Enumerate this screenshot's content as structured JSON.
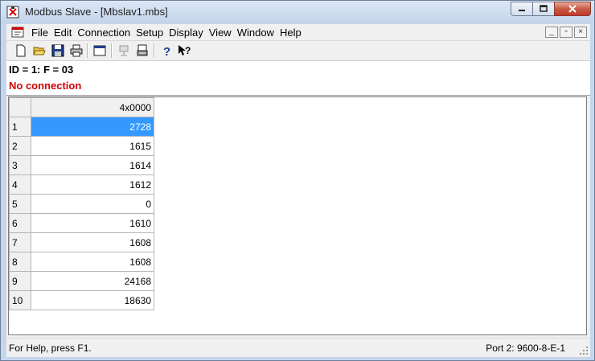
{
  "window": {
    "title": "Modbus Slave - [Mbslav1.mbs]"
  },
  "menu": [
    "File",
    "Edit",
    "Connection",
    "Setup",
    "Display",
    "View",
    "Window",
    "Help"
  ],
  "toolbar": {
    "icons": [
      "new-icon",
      "open-icon",
      "save-icon",
      "print-icon",
      "window-icon",
      "connect-icon",
      "disconnect-icon",
      "help-icon",
      "context-help-icon"
    ]
  },
  "info": {
    "id_line": "ID = 1: F = 03",
    "connection_status": "No connection",
    "status_color": "#d00000"
  },
  "grid": {
    "column_header": "4x0000",
    "rows": [
      {
        "num": "1",
        "value": "2728"
      },
      {
        "num": "2",
        "value": "1615"
      },
      {
        "num": "3",
        "value": "1614"
      },
      {
        "num": "4",
        "value": "1612"
      },
      {
        "num": "5",
        "value": "0"
      },
      {
        "num": "6",
        "value": "1610"
      },
      {
        "num": "7",
        "value": "1608"
      },
      {
        "num": "8",
        "value": "1608"
      },
      {
        "num": "9",
        "value": "24168"
      },
      {
        "num": "10",
        "value": "18630"
      }
    ],
    "selected_color": "#3399ff"
  },
  "status": {
    "left": "For Help, press F1.",
    "right": "Port 2: 9600-8-E-1"
  }
}
